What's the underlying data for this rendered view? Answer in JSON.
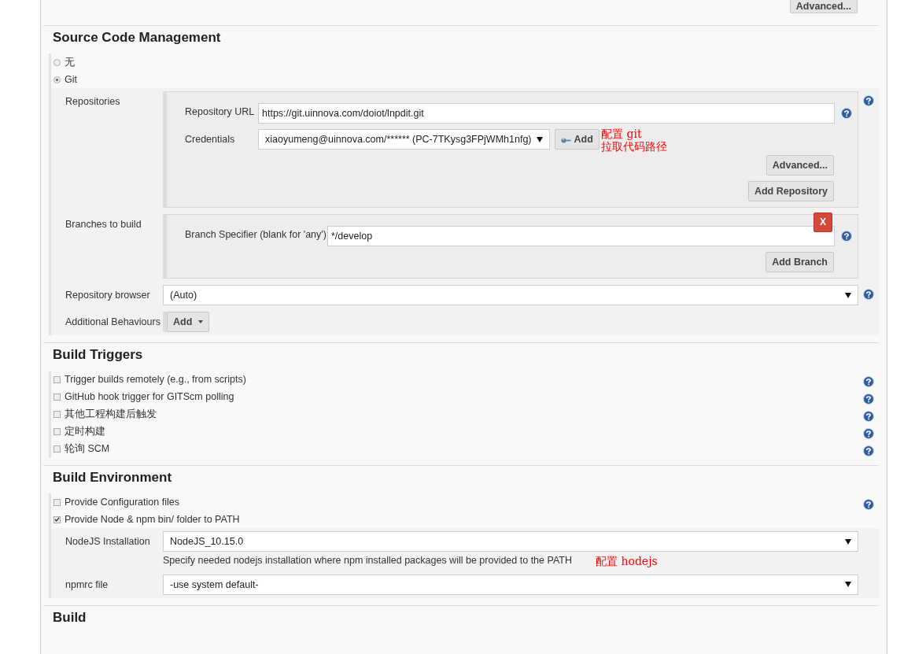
{
  "top_button": {
    "label": "Advanced..."
  },
  "scm": {
    "title": "Source Code Management",
    "options": [
      {
        "label": "无",
        "selected": false
      },
      {
        "label": "Git",
        "selected": true
      }
    ],
    "repositories": {
      "label": "Repositories",
      "url_label": "Repository URL",
      "url_value": "https://git.uinnova.com/doiot/lnpdit.git",
      "credentials_label": "Credentials",
      "credentials_value": "xiaoyumeng@uinnova.com/****** (PC-7TKysg3FPjWMh1nfg)",
      "add_label": "Add",
      "advanced_label": "Advanced...",
      "add_repository_label": "Add Repository",
      "annotation": [
        "配置 git",
        "拉取代码路径"
      ]
    },
    "branches": {
      "label": "Branches to build",
      "specifier_label": "Branch Specifier (blank for 'any')",
      "specifier_value": "*/develop",
      "delete_label": "X",
      "add_branch_label": "Add Branch"
    },
    "repository_browser": {
      "label": "Repository browser",
      "value": "(Auto)"
    },
    "additional_behaviours": {
      "label": "Additional Behaviours",
      "button_label": "Add"
    }
  },
  "build_triggers": {
    "title": "Build Triggers",
    "items": [
      {
        "label": "Trigger builds remotely (e.g., from scripts)",
        "checked": false,
        "help": true
      },
      {
        "label": "GitHub hook trigger for GITScm polling",
        "checked": false,
        "help": true
      },
      {
        "label": "其他工程构建后触发",
        "checked": false,
        "help": true
      },
      {
        "label": "定时构建",
        "checked": false,
        "help": true
      },
      {
        "label": "轮询 SCM",
        "checked": false,
        "help": true
      }
    ]
  },
  "build_environment": {
    "title": "Build Environment",
    "items": [
      {
        "label": "Provide Configuration files",
        "checked": false,
        "help": true
      },
      {
        "label": "Provide Node & npm bin/ folder to PATH",
        "checked": true,
        "help": false
      }
    ],
    "nodejs": {
      "label": "NodeJS Installation",
      "value": "NodeJS_10.15.0",
      "help_text": "Specify needed nodejs installation where npm installed packages will be provided to the PATH",
      "annotation": "配置 hodejs"
    },
    "npmrc": {
      "label": "npmrc file",
      "value": "-use system default-"
    }
  },
  "build": {
    "title": "Build"
  }
}
